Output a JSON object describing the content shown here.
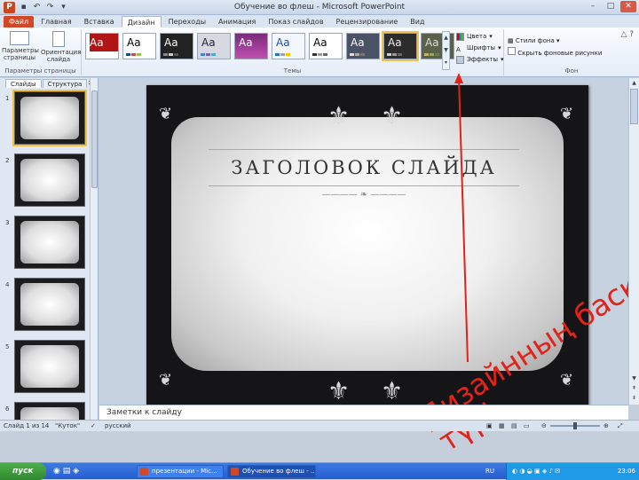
{
  "window": {
    "title": "Обучение во флеш - Microsoft PowerPoint"
  },
  "tabs": [
    "Файл",
    "Главная",
    "Вставка",
    "Дизайн",
    "Переходы",
    "Анимация",
    "Показ слайдов",
    "Рецензирование",
    "Вид"
  ],
  "ribbon": {
    "page_setup": {
      "btn1": "Параметры страницы",
      "btn2": "Ориентация слайда",
      "label": "Параметры страницы"
    },
    "themes_label": "Темы",
    "theme_sample": "Aa",
    "colors": "Цвета",
    "fonts": "Шрифты",
    "effects": "Эффекты",
    "bg_styles": "Стили фона",
    "hide_bg": "Скрыть фоновые рисунки",
    "bg_label": "Фон"
  },
  "left_pane": {
    "tabs": [
      "Слайды",
      "Структура"
    ],
    "slide_numbers": [
      "1",
      "2",
      "3",
      "4",
      "5",
      "6"
    ]
  },
  "slide": {
    "title": "ЗАГОЛОВОК СЛАЙДА",
    "annotation_line1": "Дизайнның басқа",
    "annotation_line2": "түрі"
  },
  "notes_placeholder": "Заметки к слайду",
  "status": {
    "slide_info": "Слайд 1 из 14",
    "theme_name": "\"Куток\"",
    "language": "русский"
  },
  "taskbar": {
    "start": "пуск",
    "tasks": [
      "презентации - Mic...",
      "Обучение во флеш - ..."
    ],
    "lang": "RU",
    "clock": "23:06"
  },
  "colors": {
    "annotation": "#e2231a",
    "accent": "#d24726"
  }
}
